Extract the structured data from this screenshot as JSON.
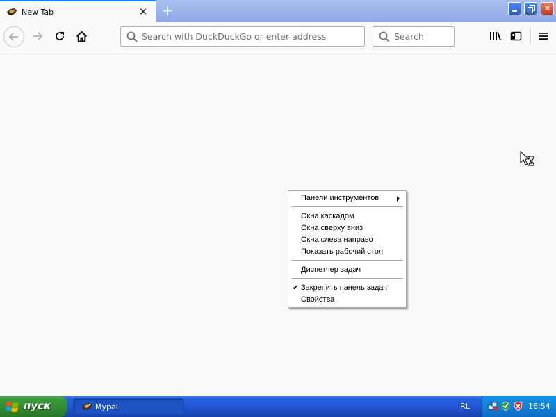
{
  "browser": {
    "tab_title": "New Tab",
    "urlbar_placeholder": "Search with DuckDuckGo or enter address",
    "searchbar_placeholder": "Search"
  },
  "context_menu": {
    "items": [
      {
        "label": "Панели инструментов",
        "submenu": true
      },
      {
        "label": "Окна каскадом"
      },
      {
        "label": "Окна сверху вниз"
      },
      {
        "label": "Окна слева направо"
      },
      {
        "label": "Показать рабочий стол"
      },
      {
        "label": "Диспетчер задач"
      },
      {
        "label": "Закрепить панель задач",
        "checked": true
      },
      {
        "label": "Свойства"
      }
    ],
    "check_glyph": "✔"
  },
  "taskbar": {
    "start_label": "пуск",
    "task_label": "Mypal",
    "language": "RL",
    "clock": "16:54"
  },
  "colors": {
    "tab_accent": "#0a84ff",
    "taskbar_blue": "#2157d7",
    "start_green": "#318a31",
    "tray_blue": "#0f82d7"
  }
}
